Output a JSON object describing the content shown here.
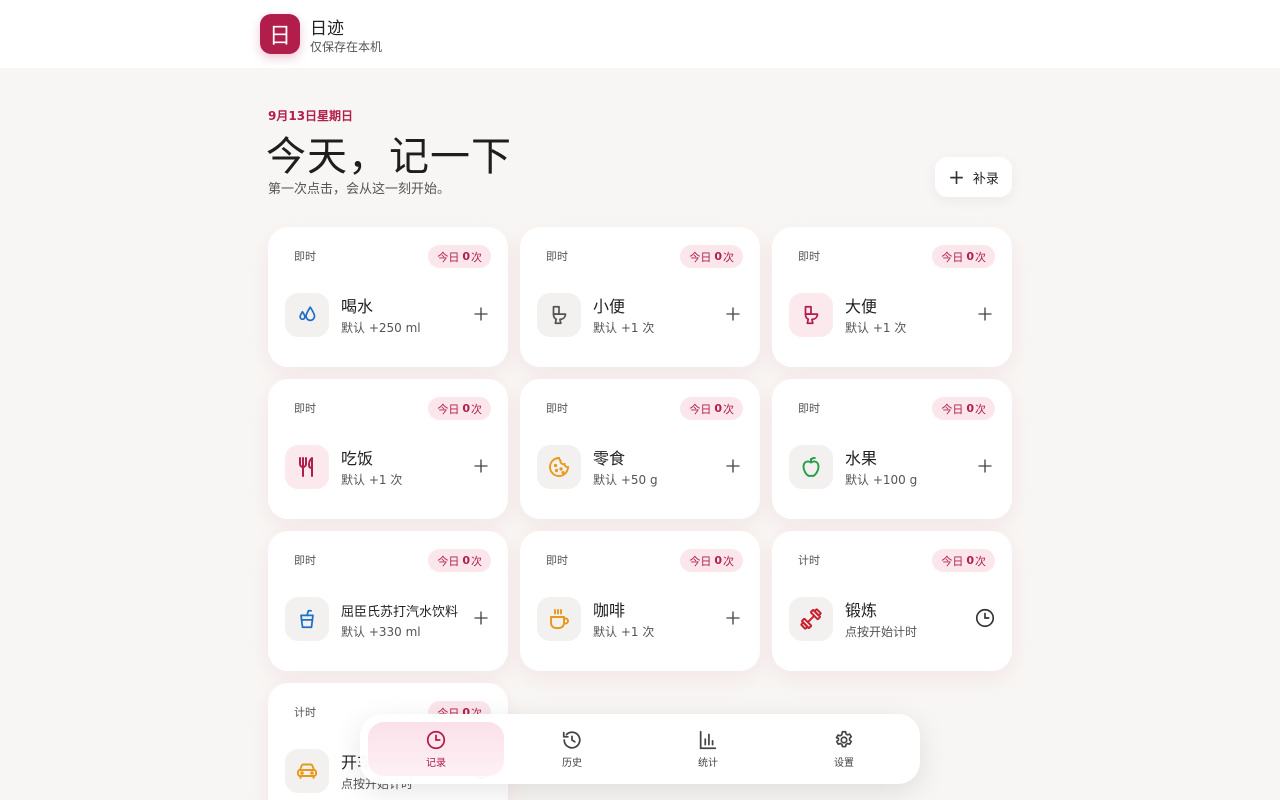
{
  "app": {
    "logo_char": "日",
    "name": "日迹",
    "subtitle": "仅保存在本机"
  },
  "header": {
    "date": "9月13日星期日",
    "title": "今天，记一下",
    "subtitle": "第一次点击，会从这一刻开始。",
    "add_record_label": "补录"
  },
  "badge": {
    "prefix": "今日",
    "suffix": "次"
  },
  "cards": [
    {
      "kind": "即时",
      "count": "0",
      "name": "喝水",
      "desc": "默认 +250 ml",
      "icon": "water-drops-icon",
      "color": "#1f6fc4"
    },
    {
      "kind": "即时",
      "count": "0",
      "name": "小便",
      "desc": "默认 +1 次",
      "icon": "toilet-icon",
      "color": "#555555"
    },
    {
      "kind": "即时",
      "count": "0",
      "name": "大便",
      "desc": "默认 +1 次",
      "icon": "toilet-icon",
      "color": "#b21e4b"
    },
    {
      "kind": "即时",
      "count": "0",
      "name": "吃饭",
      "desc": "默认 +1 次",
      "icon": "utensils-icon",
      "color": "#b21e4b"
    },
    {
      "kind": "即时",
      "count": "0",
      "name": "零食",
      "desc": "默认 +50 g",
      "icon": "cookie-icon",
      "color": "#e8981a"
    },
    {
      "kind": "即时",
      "count": "0",
      "name": "水果",
      "desc": "默认 +100 g",
      "icon": "apple-icon",
      "color": "#23a047"
    },
    {
      "kind": "即时",
      "count": "0",
      "name": "屈臣氏苏打汽水饮料",
      "desc": "默认 +330 ml",
      "icon": "soda-cup-icon",
      "color": "#1f6fc4"
    },
    {
      "kind": "即时",
      "count": "0",
      "name": "咖啡",
      "desc": "默认 +1 次",
      "icon": "coffee-icon",
      "color": "#e8981a"
    },
    {
      "kind": "计时",
      "count": "0",
      "name": "锻炼",
      "desc": "点按开始计时",
      "icon": "dumbbell-icon",
      "color": "#c8202c"
    },
    {
      "kind": "计时",
      "count": "0",
      "name": "开车",
      "desc": "点按开始计时",
      "icon": "car-icon",
      "color": "#e8981a"
    }
  ],
  "nav": [
    {
      "label": "记录",
      "icon": "clock-icon",
      "active": true
    },
    {
      "label": "历史",
      "icon": "history-icon",
      "active": false
    },
    {
      "label": "统计",
      "icon": "bar-chart-icon",
      "active": false
    },
    {
      "label": "设置",
      "icon": "gear-icon",
      "active": false
    }
  ],
  "colors": {
    "accent": "#b21e4b",
    "badge_bg": "#fbe6ec",
    "background": "#f8f6f4"
  }
}
